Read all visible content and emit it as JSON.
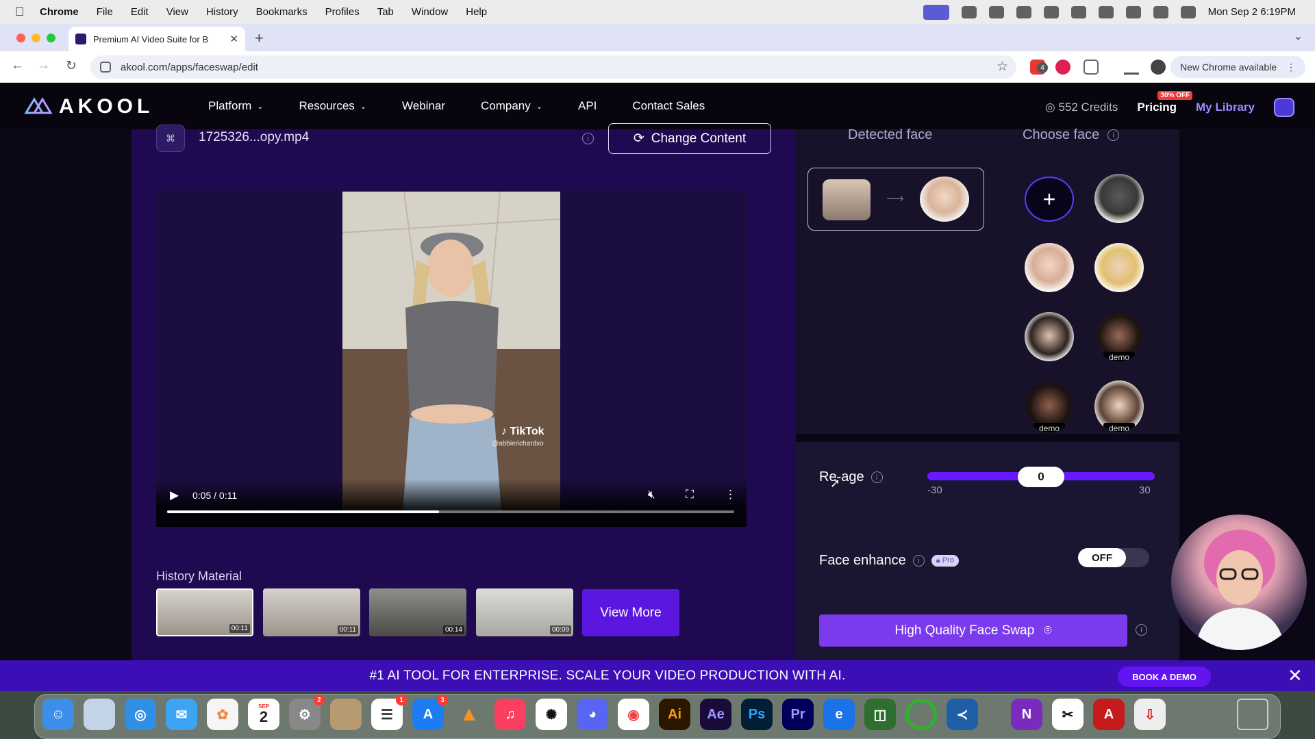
{
  "menubar": {
    "apple": "",
    "items": [
      "Chrome",
      "File",
      "Edit",
      "View",
      "History",
      "Bookmarks",
      "Profiles",
      "Tab",
      "Window",
      "Help"
    ],
    "datetime": "Mon Sep 2  6:19PM"
  },
  "browser": {
    "tab_title": "Premium AI Video Suite for B",
    "url": "akool.com/apps/faceswap/edit",
    "new_chrome": "New Chrome available",
    "ext_badge": "4"
  },
  "site": {
    "logo": "AKOOL",
    "nav": [
      {
        "label": "Platform",
        "dropdown": true
      },
      {
        "label": "Resources",
        "dropdown": true
      },
      {
        "label": "Webinar",
        "dropdown": false
      },
      {
        "label": "Company",
        "dropdown": true
      },
      {
        "label": "API",
        "dropdown": false
      },
      {
        "label": "Contact Sales",
        "dropdown": false
      }
    ],
    "credits": "552 Credits",
    "pricing": "Pricing",
    "discount_badge": "30% OFF",
    "my_library": "My Library"
  },
  "editor": {
    "filename": "1725326...opy.mp4",
    "change_content": "Change Content",
    "video": {
      "time": "0:05 / 0:11",
      "progress": 0.48,
      "watermark": "TikTok",
      "handle": "@abbierichardxo"
    },
    "history_label": "History Material",
    "history": [
      {
        "duration": "00:11",
        "selected": true
      },
      {
        "duration": "00:11",
        "selected": false
      },
      {
        "duration": "00:14",
        "selected": false
      },
      {
        "duration": "00:09",
        "selected": false
      }
    ],
    "view_more": "View More"
  },
  "faces": {
    "detected_label": "Detected face",
    "choose_label": "Choose face",
    "demo_label": "demo"
  },
  "controls": {
    "reage_label": "Re-age",
    "reage_value": "0",
    "reage_min": "-30",
    "reage_max": "30",
    "enhance_label": "Face enhance",
    "pro": "Pro",
    "toggle_state": "OFF",
    "hq_button": "High Quality Face Swap"
  },
  "banner": {
    "text": "#1 AI TOOL FOR ENTERPRISE. SCALE YOUR VIDEO PRODUCTION WITH AI.",
    "book_demo": "BOOK A DEMO"
  },
  "dock": {
    "calendar_month": "SEP",
    "calendar_day": "2",
    "badges": {
      "settings": "2",
      "reminders": "1",
      "appstore": "3"
    }
  },
  "colors": {
    "accent": "#7c3aed",
    "editor_bg": "#1f0a52",
    "banner_bg": "#3b0eb6"
  }
}
